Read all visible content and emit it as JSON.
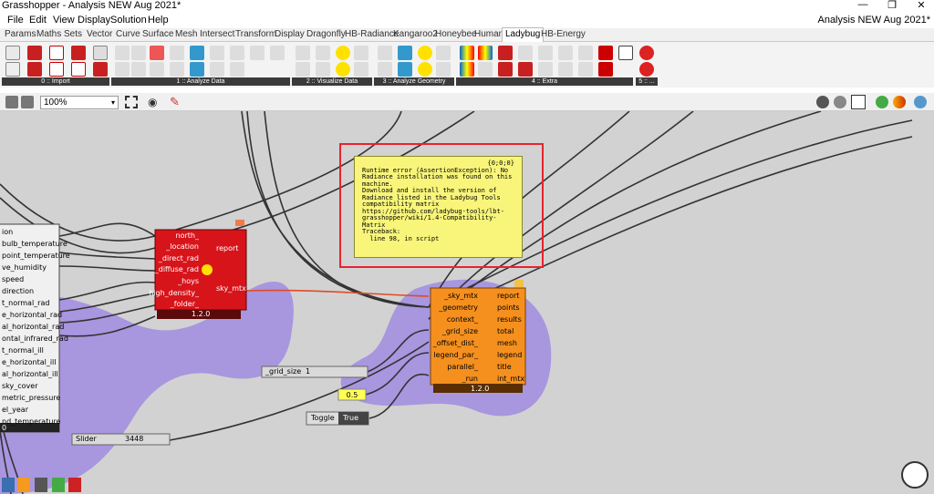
{
  "window": {
    "title": "Grasshopper - Analysis NEW Aug 2021*",
    "minimize": "—",
    "restore": "❐",
    "close": "✕"
  },
  "menu": {
    "items": [
      "File",
      "Edit",
      "View",
      "Display",
      "Solution",
      "Help"
    ],
    "document_name": "Analysis NEW Aug 2021*"
  },
  "tabs": [
    "Params",
    "Maths",
    "Sets",
    "Vector",
    "Curve",
    "Surface",
    "Mesh",
    "Intersect",
    "Transform",
    "Display",
    "Dragonfly",
    "HB-Radiance",
    "Kangaroo2",
    "Honeybee",
    "Human",
    "Ladybug",
    "HB-Energy"
  ],
  "active_tab": "Ladybug",
  "ribbon_groups": [
    "0 :: Import",
    "1 :: Analyze Data",
    "2 :: Visualize Data",
    "3 :: Analyze Geometry",
    "4 :: Extra",
    "5 :: ..."
  ],
  "canvas_toolbar": {
    "zoom": "100%"
  },
  "components": {
    "weather": {
      "outputs": [
        "ion",
        "bulb_temperature",
        "point_temperature",
        "ve_humidity",
        "speed",
        "direction",
        "t_normal_rad",
        "e_horizontal_rad",
        "al_horizontal_rad",
        "ontal_infrared_rad",
        "t_normal_ill",
        "e_horizontal_ill",
        "al_horizontal_ill",
        "sky_cover",
        "metric_pressure",
        "el_year",
        "nd_temperature"
      ],
      "footer": "0"
    },
    "red": {
      "inputs": [
        "north_",
        "_location",
        "_direct_rad",
        "_diffuse_rad",
        "_hoys",
        "high_density_",
        "_folder_"
      ],
      "outputs": [
        "report",
        "sky_mtx"
      ],
      "version": "1.2.0"
    },
    "orange": {
      "inputs": [
        "_sky_mtx",
        "_geometry",
        "context_",
        "_grid_size",
        "_offset_dist_",
        "legend_par_",
        "parallel_",
        "_run"
      ],
      "outputs": [
        "report",
        "points",
        "results",
        "total",
        "mesh",
        "legend",
        "title",
        "int_mtx"
      ],
      "version": "1.2.0"
    },
    "grid_size_slider": {
      "label": "_grid_size",
      "value": "1"
    },
    "panel_value": "0.5",
    "toggle": {
      "label": "Toggle",
      "value": "True"
    },
    "slider": {
      "label": "Slider",
      "value": "3448"
    }
  },
  "error_balloon": {
    "header": "{0;0;0}",
    "lines": [
      "Runtime error (AssertionException): No",
      "Radiance installation was found on this",
      "machine.",
      "Download and install the version of",
      "Radiance listed in the Ladybug Tools",
      "compatibility matrix",
      "https://github.com/ladybug-tools/lbt-",
      "grasshopper/wiki/1.4-Compatibility-",
      "Matrix",
      "",
      "Traceback:",
      "  line 98, in script"
    ]
  },
  "colors": {
    "group": "#a896df",
    "red_component": "#d8141b",
    "orange_component": "#f5901e",
    "error_balloon": "#f8f57a",
    "highlight_frame": "#e8232e",
    "canvas": "#d2d2d2"
  }
}
